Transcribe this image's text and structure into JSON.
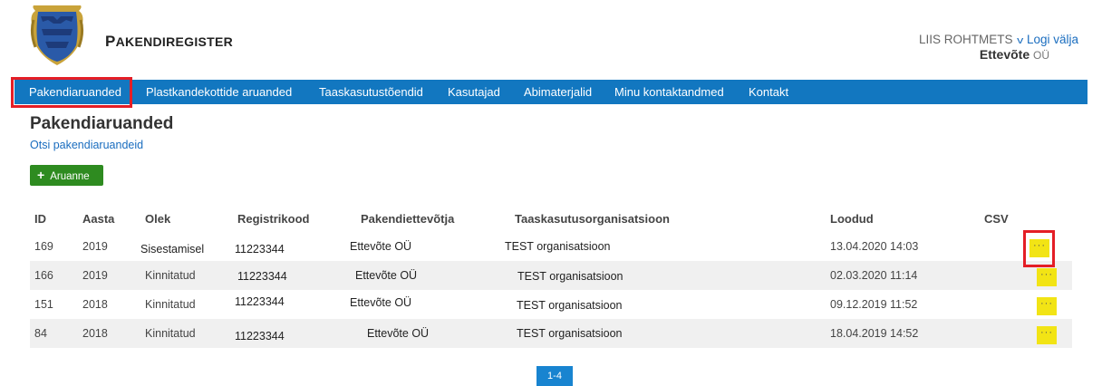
{
  "app": {
    "title": "Pakendiregister",
    "title_first": "P",
    "title_rest": "AKENDIREGISTER"
  },
  "user": {
    "name": "LIIS ROHTMETS",
    "logout": "Logi välja",
    "company_name": "Ettevõte",
    "company_suffix": "OÜ"
  },
  "nav": [
    "Pakendiaruanded",
    "Plastkandekottide aruanded",
    "Taaskasutustõendid",
    "Kasutajad",
    "Abimaterjalid",
    "Minu kontaktandmed",
    "Kontakt"
  ],
  "page": {
    "title": "Pakendiaruanded",
    "search_link": "Otsi pakendiaruandeid",
    "add_button": "Aruanne"
  },
  "table": {
    "headers": [
      "ID",
      "Aasta",
      "Olek",
      "Registrikood",
      "Pakendiettevõtja",
      "Taaskasutusorganisatsioon",
      "Loodud",
      "CSV"
    ],
    "rows": [
      {
        "id": "169",
        "year": "2019",
        "status": "Sisestamisel",
        "reg": "11223344",
        "company": "Ettevõte OÜ",
        "org": "TEST organisatsioon",
        "created": "13.04.2020 14:03",
        "action": "···"
      },
      {
        "id": "166",
        "year": "2019",
        "status": "Kinnitatud",
        "reg": "11223344",
        "company": "Ettevõte OÜ",
        "org": "TEST organisatsioon",
        "created": "02.03.2020 11:14",
        "action": "···"
      },
      {
        "id": "151",
        "year": "2018",
        "status": "Kinnitatud",
        "reg": "11223344",
        "company": "Ettevõte OÜ",
        "org": "TEST organisatsioon",
        "created": "09.12.2019 11:52",
        "action": "···"
      },
      {
        "id": "84",
        "year": "2018",
        "status": "Kinnitatud",
        "reg": "11223344",
        "company": "Ettevõte OÜ",
        "org": "TEST organisatsioon",
        "created": "18.04.2019 14:52",
        "action": "···"
      }
    ]
  },
  "pagination": {
    "label": "1-4"
  },
  "colors": {
    "nav_bg": "#1277c0",
    "add_button": "#2e8b20",
    "action_button": "#f2e415",
    "highlight": "#e41e26",
    "link": "#1a6dbf"
  }
}
